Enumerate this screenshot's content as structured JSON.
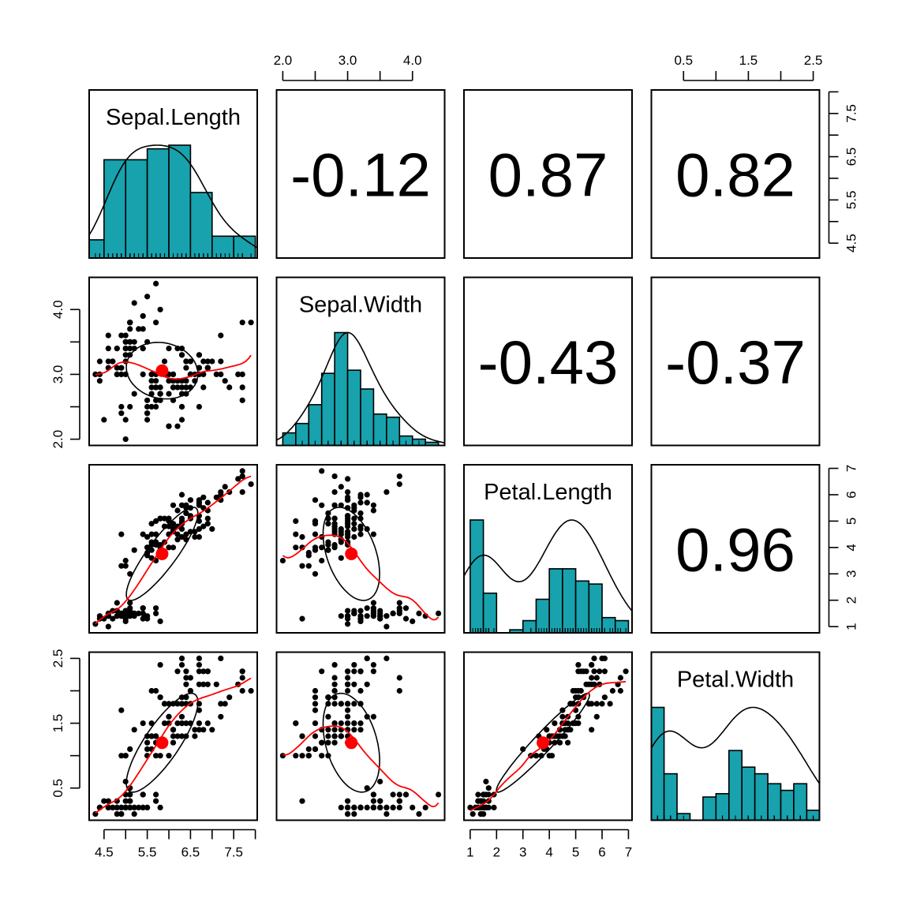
{
  "chart_data": {
    "type": "scatter",
    "title": "",
    "variables": [
      "Sepal.Length",
      "Sepal.Width",
      "Petal.Length",
      "Petal.Width"
    ],
    "correlations": [
      {
        "row": 0,
        "col": 1,
        "label": "-0.12",
        "value": -0.12
      },
      {
        "row": 0,
        "col": 2,
        "label": "0.87",
        "value": 0.87
      },
      {
        "row": 0,
        "col": 3,
        "label": "0.82",
        "value": 0.82
      },
      {
        "row": 1,
        "col": 2,
        "label": "-0.43",
        "value": -0.43
      },
      {
        "row": 1,
        "col": 3,
        "label": "-0.37",
        "value": -0.37
      },
      {
        "row": 2,
        "col": 3,
        "label": "0.96",
        "value": 0.96
      }
    ],
    "ranges": [
      [
        4.3,
        7.9
      ],
      [
        2.0,
        4.4
      ],
      [
        1.0,
        6.9
      ],
      [
        0.1,
        2.5
      ]
    ],
    "axes": {
      "top": [
        {
          "col": 1,
          "ticks": [
            2.0,
            2.5,
            3.0,
            3.5,
            4.0
          ],
          "labels": [
            {
              "v": 2.0,
              "t": "2.0"
            },
            {
              "v": 3.0,
              "t": "3.0"
            },
            {
              "v": 4.0,
              "t": "4.0"
            }
          ]
        },
        {
          "col": 3,
          "ticks": [
            0.5,
            1.0,
            1.5,
            2.0,
            2.5
          ],
          "labels": [
            {
              "v": 0.5,
              "t": "0.5"
            },
            {
              "v": 1.5,
              "t": "1.5"
            },
            {
              "v": 2.5,
              "t": "2.5"
            }
          ]
        }
      ],
      "right": [
        {
          "row": 0,
          "ticks": [
            4.5,
            5.0,
            5.5,
            6.0,
            6.5,
            7.0,
            7.5,
            8.0
          ],
          "labels": [
            {
              "v": 4.5,
              "t": "4.5"
            },
            {
              "v": 5.5,
              "t": "5.5"
            },
            {
              "v": 6.5,
              "t": "6.5"
            },
            {
              "v": 7.5,
              "t": "7.5"
            }
          ]
        },
        {
          "row": 2,
          "ticks": [
            1,
            2,
            3,
            4,
            5,
            6,
            7
          ],
          "labels": [
            {
              "v": 1,
              "t": "1"
            },
            {
              "v": 2,
              "t": "2"
            },
            {
              "v": 3,
              "t": "3"
            },
            {
              "v": 4,
              "t": "4"
            },
            {
              "v": 5,
              "t": "5"
            },
            {
              "v": 6,
              "t": "6"
            },
            {
              "v": 7,
              "t": "7"
            }
          ]
        }
      ],
      "left": [
        {
          "row": 1,
          "ticks": [
            2.0,
            2.5,
            3.0,
            3.5,
            4.0
          ],
          "labels": [
            {
              "v": 2.0,
              "t": "2.0"
            },
            {
              "v": 3.0,
              "t": "3.0"
            },
            {
              "v": 4.0,
              "t": "4.0"
            }
          ]
        },
        {
          "row": 3,
          "ticks": [
            0.5,
            1.0,
            1.5,
            2.0,
            2.5
          ],
          "labels": [
            {
              "v": 0.5,
              "t": "0.5"
            },
            {
              "v": 1.5,
              "t": "1.5"
            },
            {
              "v": 2.5,
              "t": "2.5"
            }
          ]
        }
      ],
      "bottom": [
        {
          "col": 0,
          "ticks": [
            4.5,
            5.0,
            5.5,
            6.0,
            6.5,
            7.0,
            7.5,
            8.0
          ],
          "labels": [
            {
              "v": 4.5,
              "t": "4.5"
            },
            {
              "v": 5.5,
              "t": "5.5"
            },
            {
              "v": 6.5,
              "t": "6.5"
            },
            {
              "v": 7.5,
              "t": "7.5"
            }
          ]
        },
        {
          "col": 2,
          "ticks": [
            1,
            2,
            3,
            4,
            5,
            6,
            7
          ],
          "labels": [
            {
              "v": 1,
              "t": "1"
            },
            {
              "v": 2,
              "t": "2"
            },
            {
              "v": 3,
              "t": "3"
            },
            {
              "v": 4,
              "t": "4"
            },
            {
              "v": 5,
              "t": "5"
            },
            {
              "v": 6,
              "t": "6"
            },
            {
              "v": 7,
              "t": "7"
            }
          ]
        }
      ]
    },
    "histograms": [
      {
        "var": "Sepal.Length",
        "breaks": [
          4.0,
          4.5,
          5.0,
          5.5,
          6.0,
          6.5,
          7.0,
          7.5,
          8.0
        ],
        "counts": [
          5,
          27,
          27,
          30,
          31,
          18,
          6,
          6
        ]
      },
      {
        "var": "Sepal.Width",
        "breaks": [
          2.0,
          2.2,
          2.4,
          2.6,
          2.8,
          3.0,
          3.2,
          3.4,
          3.6,
          3.8,
          4.0,
          4.2,
          4.4
        ],
        "counts": [
          4,
          7,
          13,
          23,
          36,
          24,
          18,
          10,
          9,
          3,
          2,
          1
        ]
      },
      {
        "var": "Petal.Length",
        "breaks": [
          1.0,
          1.5,
          2.0,
          2.5,
          3.0,
          3.5,
          4.0,
          4.5,
          5.0,
          5.5,
          6.0,
          6.5,
          7.0
        ],
        "counts": [
          37,
          13,
          0,
          1,
          4,
          11,
          21,
          21,
          17,
          16,
          5,
          4
        ]
      },
      {
        "var": "Petal.Width",
        "breaks": [
          0.0,
          0.2,
          0.4,
          0.6,
          0.8,
          1.0,
          1.2,
          1.4,
          1.6,
          1.8,
          2.0,
          2.2,
          2.4,
          2.6
        ],
        "counts": [
          34,
          14,
          2,
          0,
          7,
          8,
          21,
          16,
          14,
          11,
          9,
          11,
          3
        ]
      }
    ],
    "means": [
      5.843,
      3.057,
      3.758,
      1.199
    ],
    "colors": {
      "hist_fill": "#17a2ad",
      "smooth": "#ff0000",
      "points": "#000000",
      "ellipse": "#000000"
    },
    "data": {
      "Sepal.Length": [
        5.1,
        4.9,
        4.7,
        4.6,
        5.0,
        5.4,
        4.6,
        5.0,
        4.4,
        4.9,
        5.4,
        4.8,
        4.8,
        4.3,
        5.8,
        5.7,
        5.4,
        5.1,
        5.7,
        5.1,
        5.4,
        5.1,
        4.6,
        5.1,
        4.8,
        5.0,
        5.0,
        5.2,
        5.2,
        4.7,
        4.8,
        5.4,
        5.2,
        5.5,
        4.9,
        5.0,
        5.5,
        4.9,
        4.4,
        5.1,
        5.0,
        4.5,
        4.4,
        5.0,
        5.1,
        4.8,
        5.1,
        4.6,
        5.3,
        5.0,
        7.0,
        6.4,
        6.9,
        5.5,
        6.5,
        5.7,
        6.3,
        4.9,
        6.6,
        5.2,
        5.0,
        5.9,
        6.0,
        6.1,
        5.6,
        6.7,
        5.6,
        5.8,
        6.2,
        5.6,
        5.9,
        6.1,
        6.3,
        6.1,
        6.4,
        6.6,
        6.8,
        6.7,
        6.0,
        5.7,
        5.5,
        5.5,
        5.8,
        6.0,
        5.4,
        6.0,
        6.7,
        6.3,
        5.6,
        5.5,
        5.5,
        6.1,
        5.8,
        5.0,
        5.6,
        5.7,
        5.7,
        6.2,
        5.1,
        5.7,
        6.3,
        5.8,
        7.1,
        6.3,
        6.5,
        7.6,
        4.9,
        7.3,
        6.7,
        7.2,
        6.5,
        6.4,
        6.8,
        5.7,
        5.8,
        6.4,
        6.5,
        7.7,
        7.7,
        6.0,
        6.9,
        5.6,
        7.7,
        6.3,
        6.7,
        7.2,
        6.2,
        6.1,
        6.4,
        7.2,
        7.4,
        7.9,
        6.4,
        6.3,
        6.1,
        7.7,
        6.3,
        6.4,
        6.0,
        6.9,
        6.7,
        6.9,
        5.8,
        6.8,
        6.7,
        6.7,
        6.3,
        6.5,
        6.2,
        5.9
      ],
      "Sepal.Width": [
        3.5,
        3.0,
        3.2,
        3.1,
        3.6,
        3.9,
        3.4,
        3.4,
        2.9,
        3.1,
        3.7,
        3.4,
        3.0,
        3.0,
        4.0,
        4.4,
        3.9,
        3.5,
        3.8,
        3.8,
        3.4,
        3.7,
        3.6,
        3.3,
        3.4,
        3.0,
        3.4,
        3.5,
        3.4,
        3.2,
        3.1,
        3.4,
        4.1,
        4.2,
        3.1,
        3.2,
        3.5,
        3.6,
        3.0,
        3.4,
        3.5,
        2.3,
        3.2,
        3.5,
        3.8,
        3.0,
        3.8,
        3.2,
        3.7,
        3.3,
        3.2,
        3.2,
        3.1,
        2.3,
        2.8,
        2.8,
        3.3,
        2.4,
        2.9,
        2.7,
        2.0,
        3.0,
        2.2,
        2.9,
        2.9,
        3.1,
        3.0,
        2.7,
        2.2,
        2.5,
        3.2,
        2.8,
        2.5,
        2.8,
        2.9,
        3.0,
        2.8,
        3.0,
        2.9,
        2.6,
        2.4,
        2.4,
        2.7,
        2.7,
        3.0,
        3.4,
        3.1,
        2.3,
        3.0,
        2.5,
        2.6,
        3.0,
        2.6,
        2.3,
        2.7,
        3.0,
        2.9,
        2.9,
        2.5,
        2.8,
        3.3,
        2.7,
        3.0,
        2.9,
        3.0,
        3.0,
        2.5,
        2.9,
        2.5,
        3.6,
        3.2,
        2.7,
        3.0,
        2.5,
        2.8,
        3.2,
        3.0,
        3.8,
        2.6,
        2.2,
        3.2,
        2.8,
        2.8,
        2.7,
        3.3,
        3.2,
        2.8,
        3.0,
        2.8,
        3.0,
        2.8,
        3.8,
        2.8,
        2.8,
        2.6,
        3.0,
        3.4,
        3.1,
        3.0,
        3.1,
        3.1,
        3.1,
        2.7,
        3.2,
        3.3,
        3.0,
        2.5,
        3.0,
        3.4,
        3.0
      ],
      "Petal.Length": [
        1.4,
        1.4,
        1.3,
        1.5,
        1.4,
        1.7,
        1.4,
        1.5,
        1.4,
        1.5,
        1.5,
        1.6,
        1.4,
        1.1,
        1.2,
        1.5,
        1.3,
        1.4,
        1.7,
        1.5,
        1.7,
        1.5,
        1.0,
        1.7,
        1.9,
        1.6,
        1.6,
        1.5,
        1.4,
        1.6,
        1.6,
        1.5,
        1.5,
        1.4,
        1.5,
        1.2,
        1.3,
        1.4,
        1.3,
        1.5,
        1.3,
        1.3,
        1.3,
        1.6,
        1.9,
        1.4,
        1.6,
        1.4,
        1.5,
        1.4,
        4.7,
        4.5,
        4.9,
        4.0,
        4.6,
        4.5,
        4.7,
        3.3,
        4.6,
        3.9,
        3.5,
        4.2,
        4.0,
        4.7,
        3.6,
        4.4,
        4.5,
        4.1,
        4.5,
        3.9,
        4.8,
        4.0,
        4.9,
        4.7,
        4.3,
        4.4,
        4.8,
        5.0,
        4.5,
        3.5,
        3.8,
        3.7,
        3.9,
        5.1,
        4.5,
        4.5,
        4.7,
        4.4,
        4.1,
        4.0,
        4.4,
        4.6,
        4.0,
        3.3,
        4.2,
        4.2,
        4.2,
        4.3,
        3.0,
        4.1,
        6.0,
        5.1,
        5.9,
        5.6,
        5.8,
        6.6,
        4.5,
        6.3,
        5.8,
        6.1,
        5.1,
        5.3,
        5.5,
        5.0,
        5.1,
        5.3,
        5.5,
        6.7,
        6.9,
        5.0,
        5.7,
        4.9,
        6.7,
        4.9,
        5.7,
        6.0,
        4.8,
        4.9,
        5.6,
        5.8,
        6.1,
        6.4,
        5.6,
        5.1,
        5.6,
        6.1,
        5.6,
        5.5,
        4.8,
        5.4,
        5.6,
        5.1,
        5.1,
        5.9,
        5.7,
        5.2,
        5.0,
        5.2,
        5.4,
        5.1
      ],
      "Petal.Width": [
        0.2,
        0.2,
        0.2,
        0.2,
        0.2,
        0.4,
        0.3,
        0.2,
        0.2,
        0.1,
        0.2,
        0.2,
        0.1,
        0.1,
        0.2,
        0.4,
        0.4,
        0.3,
        0.3,
        0.3,
        0.2,
        0.4,
        0.2,
        0.5,
        0.2,
        0.2,
        0.4,
        0.2,
        0.2,
        0.2,
        0.2,
        0.4,
        0.1,
        0.2,
        0.2,
        0.2,
        0.2,
        0.1,
        0.2,
        0.2,
        0.3,
        0.3,
        0.2,
        0.6,
        0.4,
        0.3,
        0.2,
        0.2,
        0.2,
        0.2,
        1.4,
        1.5,
        1.5,
        1.3,
        1.5,
        1.3,
        1.6,
        1.0,
        1.3,
        1.4,
        1.0,
        1.5,
        1.0,
        1.4,
        1.3,
        1.4,
        1.5,
        1.0,
        1.5,
        1.1,
        1.8,
        1.3,
        1.5,
        1.2,
        1.3,
        1.4,
        1.4,
        1.7,
        1.5,
        1.0,
        1.1,
        1.0,
        1.2,
        1.6,
        1.5,
        1.6,
        1.5,
        1.3,
        1.3,
        1.3,
        1.2,
        1.4,
        1.2,
        1.0,
        1.3,
        1.2,
        1.3,
        1.3,
        1.1,
        1.3,
        2.5,
        1.9,
        2.1,
        1.8,
        2.2,
        2.1,
        1.7,
        1.8,
        1.8,
        2.5,
        2.0,
        1.9,
        2.1,
        2.0,
        2.4,
        2.3,
        1.8,
        2.2,
        2.3,
        1.5,
        2.3,
        2.0,
        2.0,
        1.8,
        2.1,
        1.8,
        1.8,
        1.8,
        2.1,
        1.6,
        1.9,
        2.0,
        2.2,
        1.5,
        1.4,
        2.3,
        2.4,
        1.8,
        1.8,
        2.1,
        2.4,
        2.3,
        1.9,
        2.3,
        2.5,
        2.3,
        1.9,
        2.0,
        2.3,
        1.8
      ]
    }
  }
}
